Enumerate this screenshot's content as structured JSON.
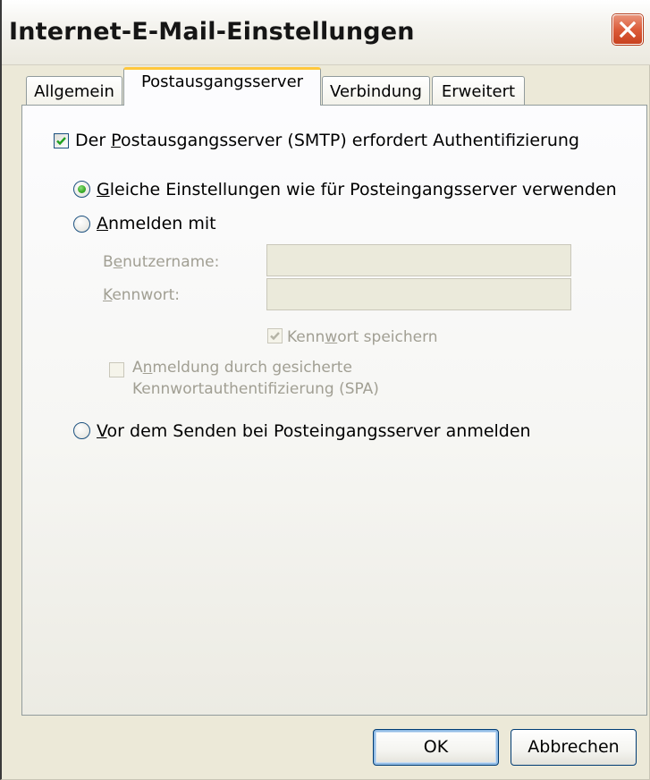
{
  "window": {
    "title": "Internet-E-Mail-Einstellungen"
  },
  "tabs": [
    {
      "label": "Allgemein",
      "active": false
    },
    {
      "label": "Postausgangsserver",
      "active": true
    },
    {
      "label": "Verbindung",
      "active": false
    },
    {
      "label": "Erweitert",
      "active": false
    }
  ],
  "smtp_auth": {
    "checked": true,
    "pre": "Der ",
    "mnemonic": "P",
    "post": "ostausgangsserver (SMTP) erfordert Authentifizierung"
  },
  "radio_same": {
    "selected": true,
    "mnemonic": "G",
    "post": "leiche Einstellungen wie für Posteingangsserver verwenden"
  },
  "radio_login": {
    "selected": false,
    "mnemonic": "A",
    "post": "nmelden mit"
  },
  "username": {
    "pre": "B",
    "mnemonic": "e",
    "post": "nutzername:",
    "value": "",
    "enabled": false
  },
  "password": {
    "mnemonic": "K",
    "post": "ennwort:",
    "value": "",
    "enabled": false
  },
  "save_password": {
    "checked": true,
    "enabled": false,
    "pre": "Kenn",
    "mnemonic": "w",
    "post": "ort speichern"
  },
  "spa": {
    "checked": false,
    "enabled": false,
    "line1_pre": "A",
    "line1_mnemonic": "n",
    "line1_post": "meldung durch gesicherte",
    "line2": "Kennwortauthentifizierung (SPA)"
  },
  "radio_before_send": {
    "selected": false,
    "mnemonic": "V",
    "post": "or dem Senden bei Posteingangsserver anmelden"
  },
  "buttons": {
    "ok": "OK",
    "cancel": "Abbrechen"
  },
  "colors": {
    "dialog_bg": "#ECE9D8",
    "active_tab_accent": "#FFC83C",
    "close_button": "#DC5C3A",
    "check_green": "#21A121",
    "disabled_text": "#A19F93"
  }
}
